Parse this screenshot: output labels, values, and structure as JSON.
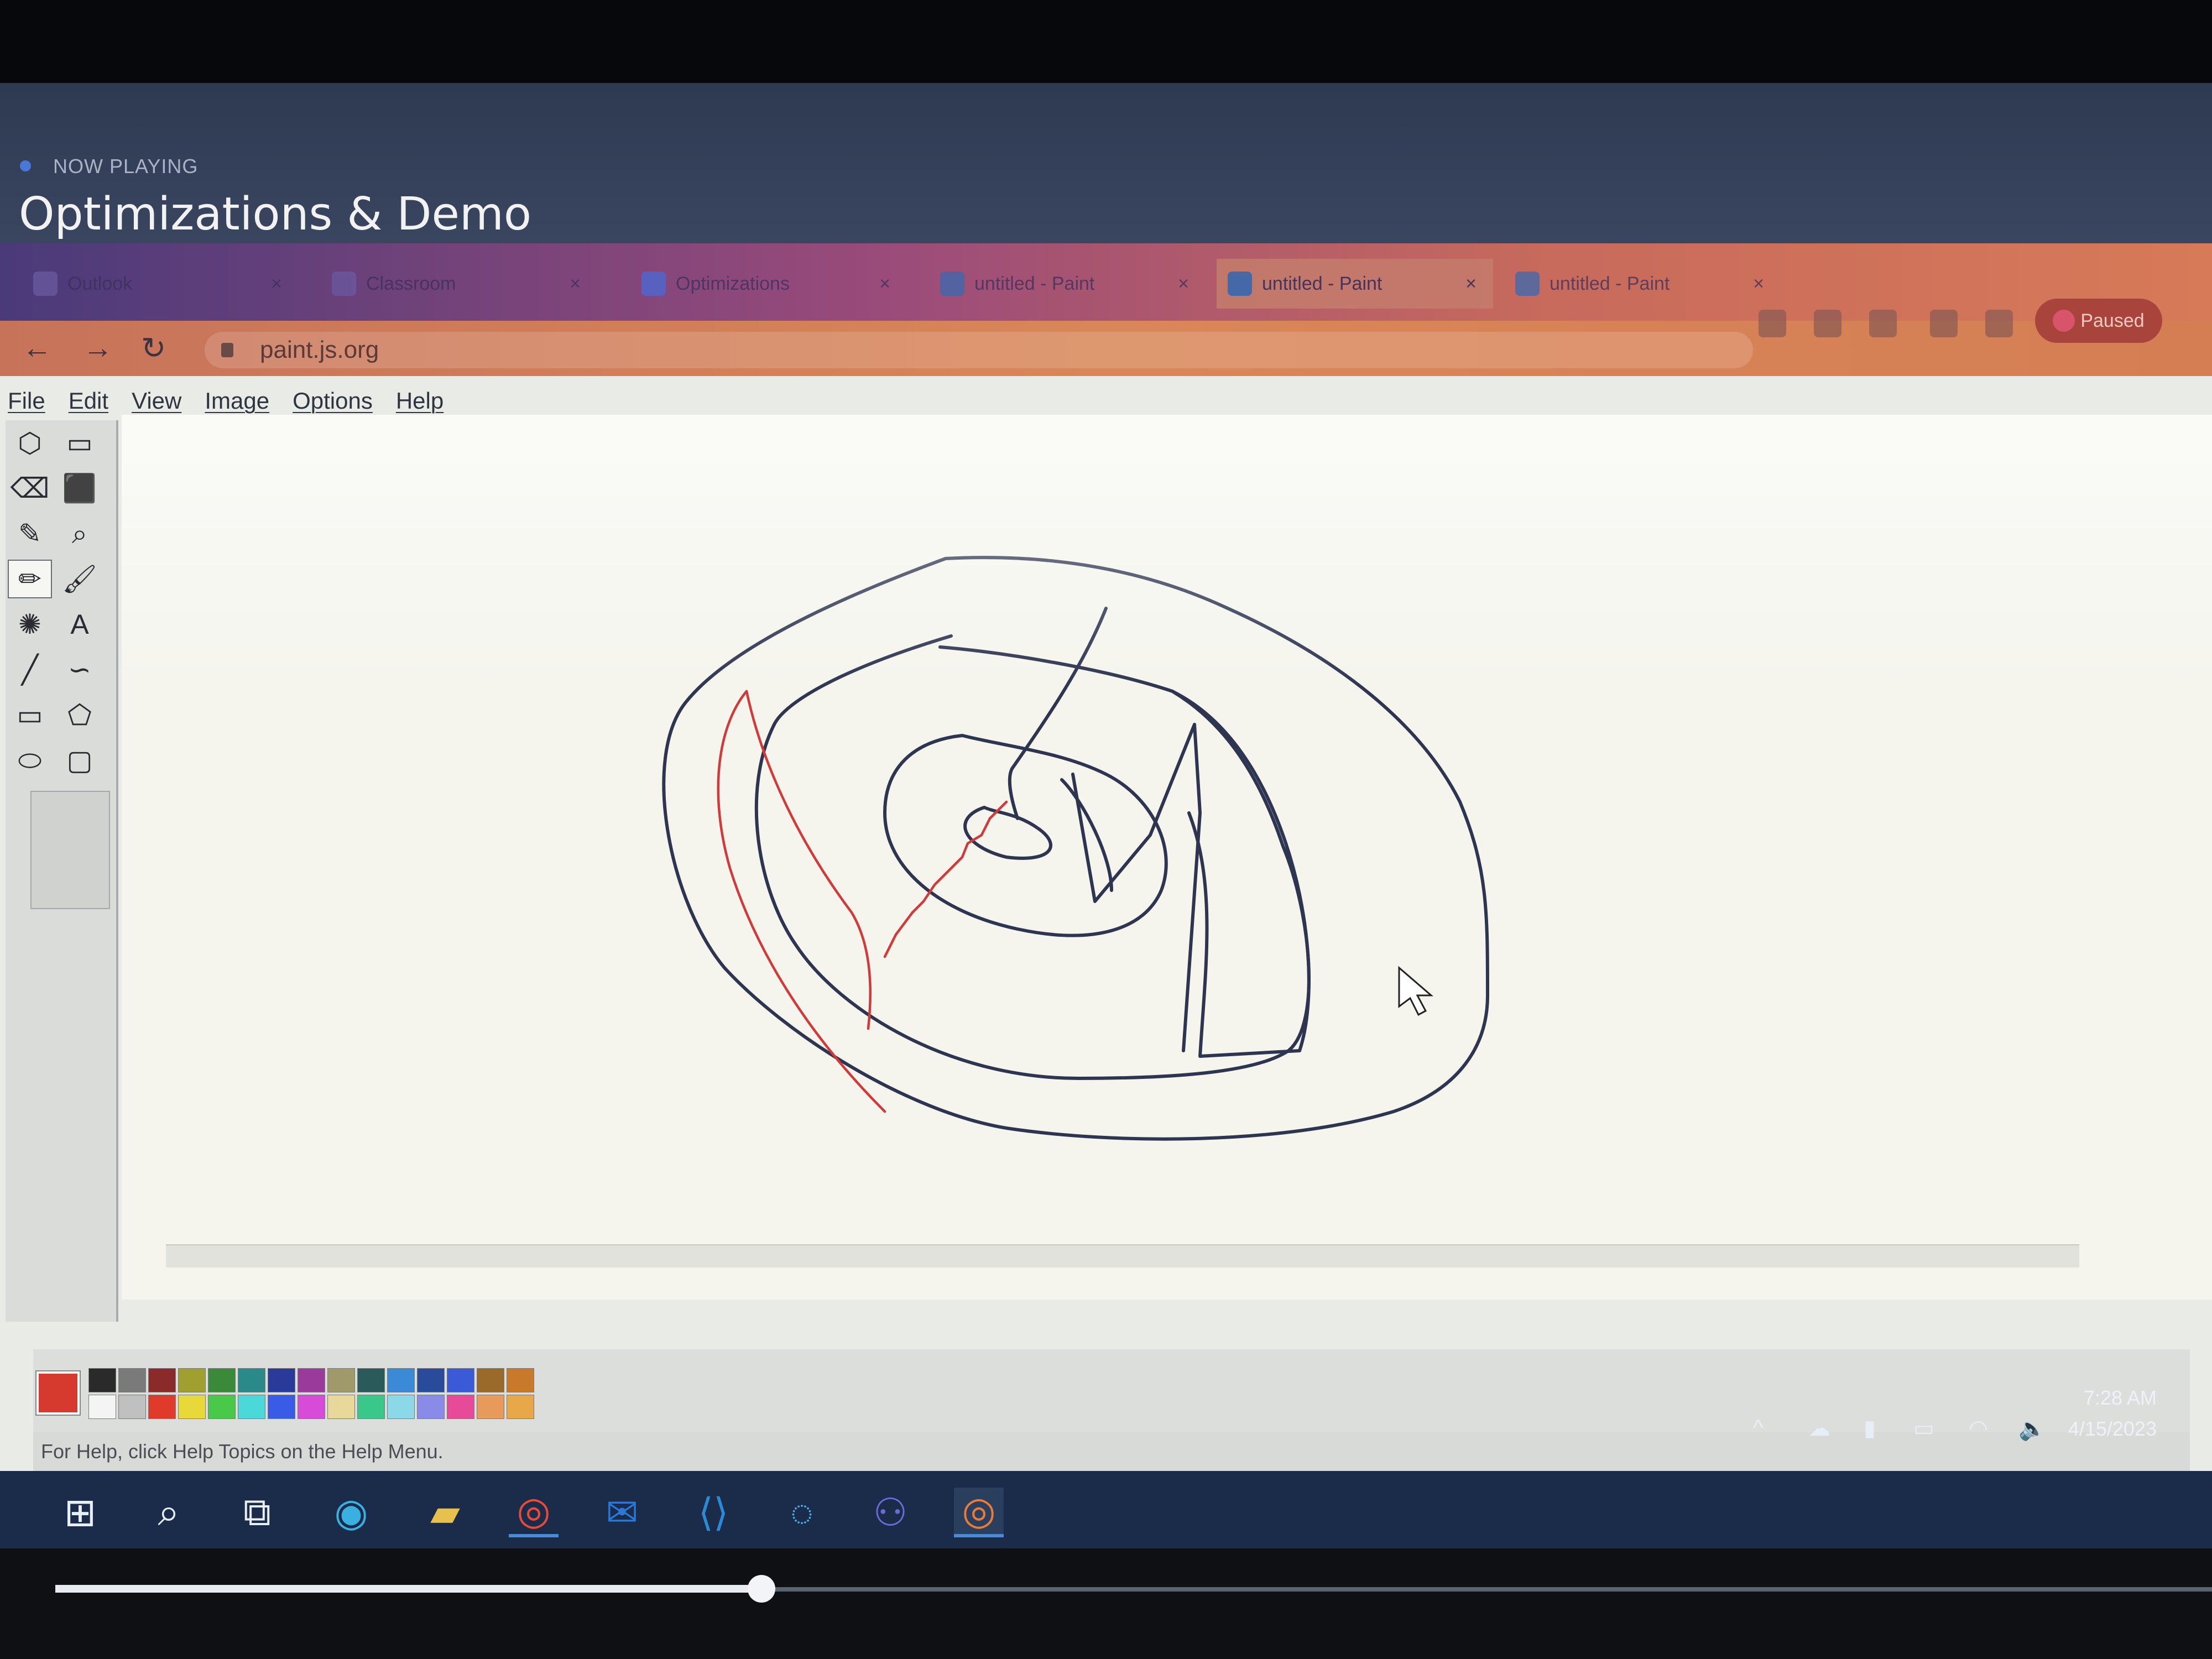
{
  "video": {
    "now_playing": "NOW PLAYING",
    "title": "Optimizations & Demo"
  },
  "browser": {
    "tabs": [
      {
        "label": "Outlook",
        "active": false
      },
      {
        "label": "Classroom",
        "active": false
      },
      {
        "label": "Optimizations",
        "active": false
      },
      {
        "label": "untitled - Paint",
        "active": false
      },
      {
        "label": "untitled - Paint",
        "active": true
      },
      {
        "label": "untitled - Paint",
        "active": false
      }
    ],
    "url": "paint.js.org",
    "paused_label": "Paused"
  },
  "paint": {
    "menu": [
      "File",
      "Edit",
      "View",
      "Image",
      "Options",
      "Help"
    ],
    "tools": [
      "free-form-select-icon",
      "select-icon",
      "eraser-icon",
      "fill-icon",
      "pick-color-icon",
      "magnifier-icon",
      "pencil-icon",
      "brush-icon",
      "airbrush-icon",
      "text-icon",
      "line-icon",
      "curve-icon",
      "rectangle-icon",
      "polygon-icon",
      "ellipse-icon",
      "rounded-rectangle-icon"
    ],
    "selected_tool": "pencil-icon",
    "primary_color": "#d63a2e",
    "palette": [
      "#2a2a2a",
      "#7a7a7a",
      "#8a2a2a",
      "#a0a030",
      "#3a8a3a",
      "#2a8a8a",
      "#2a3a9a",
      "#9a3a9a",
      "#a09a6a",
      "#2a5a5a",
      "#3a8ad8",
      "#2a4a9a",
      "#3a5ad8",
      "#9a6a2a",
      "#c87a2a",
      "#f4f4f4",
      "#c0c0c0",
      "#e03a2a",
      "#e8d83a",
      "#4ac84a",
      "#4ad8d8",
      "#3a5ae8",
      "#d84ad8",
      "#e8d89a",
      "#3ac88a",
      "#8ad8e8",
      "#8a8ae8",
      "#e84a9a",
      "#e89a5a",
      "#e8a84a"
    ],
    "status": "For Help, click Help Topics on the Help Menu."
  },
  "tray": {
    "time": "7:28 AM",
    "date": "4/15/2023"
  },
  "taskbar": {
    "apps": [
      "windows-start-icon",
      "search-icon",
      "task-view-icon",
      "edge-icon",
      "file-explorer-icon",
      "chrome-icon",
      "outlook-icon",
      "vscode-icon",
      "cortana-icon",
      "teams-icon",
      "chrome-profile-icon"
    ]
  }
}
